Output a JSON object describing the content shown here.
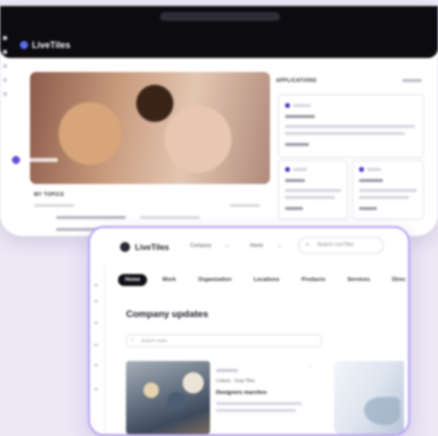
{
  "back_window": {
    "nav": [
      "",
      "",
      "",
      "",
      "",
      "",
      "",
      "",
      ""
    ],
    "hero": {
      "line1": "",
      "line2": ""
    },
    "my_topics": "MY TOPICS",
    "applications": "APPLICATIONS"
  },
  "front_window": {
    "brand": "LiveTiles",
    "dropdowns": [
      {
        "label": "Company",
        "icon": "chevron-down-icon"
      },
      {
        "label": "Home",
        "icon": "chevron-down-icon"
      }
    ],
    "search_placeholder": "Search LiveTiles",
    "tabs": [
      {
        "label": "Home",
        "active": true
      },
      {
        "label": "Work",
        "active": false
      },
      {
        "label": "Organization",
        "active": false
      },
      {
        "label": "Locations",
        "active": false
      },
      {
        "label": "Products",
        "active": false
      },
      {
        "label": "Services",
        "active": false
      },
      {
        "label": "Direc",
        "active": false
      }
    ],
    "heading": "Company updates",
    "filter_placeholder": "Search news",
    "news_card": {
      "meta": "Culture · Gray Tiles",
      "headline": "Designers marches"
    }
  }
}
